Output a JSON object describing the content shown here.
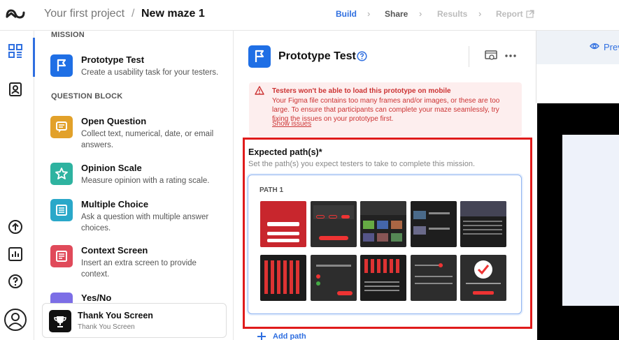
{
  "header": {
    "project": "Your first project",
    "separator": "/",
    "current": "New maze 1",
    "steps": [
      {
        "label": "Build",
        "state": "active"
      },
      {
        "label": "Share",
        "state": "normal"
      },
      {
        "label": "Results",
        "state": "disabled"
      },
      {
        "label": "Report",
        "state": "disabled"
      }
    ]
  },
  "rail": {
    "icons": [
      "blocks-icon",
      "templates-icon",
      "upload-icon",
      "analytics-icon",
      "help-icon",
      "account-icon"
    ]
  },
  "blocks": {
    "section_mission": "MISSION",
    "section_question": "QUESTION BLOCK",
    "items": [
      {
        "title": "Prototype Test",
        "desc": "Create a usability task for your testers.",
        "color": "#1f6fe5",
        "icon": "flag-icon"
      },
      {
        "title": "Open Question",
        "desc": "Collect text, numerical, date, or email answers.",
        "color": "#e2a12a",
        "icon": "chat-icon"
      },
      {
        "title": "Opinion Scale",
        "desc": "Measure opinion with a rating scale.",
        "color": "#2eb3a0",
        "icon": "star-icon"
      },
      {
        "title": "Multiple Choice",
        "desc": "Ask a question with multiple answer choices.",
        "color": "#2aa8c9",
        "icon": "list-icon"
      },
      {
        "title": "Context Screen",
        "desc": "Insert an extra screen to provide context.",
        "color": "#e04a5a",
        "icon": "document-icon"
      },
      {
        "title": "Yes/No",
        "desc": "",
        "color": "#7c6ee6",
        "icon": "yes-no-icon"
      }
    ],
    "thank_you": {
      "title": "Thank You Screen",
      "subtitle": "Thank You Screen",
      "color": "#111111",
      "icon": "trophy-icon"
    }
  },
  "editor": {
    "title": "Prototype Test",
    "warning": {
      "title": "Testers won't be able to load this prototype on mobile",
      "body": "Your Figma file contains too many frames and/or images, or these are too large. To ensure that participants can complete your maze seamlessly, try fixing the issues on your prototype first.",
      "link": "Show issues"
    },
    "expected_title": "Expected path(s)*",
    "expected_desc": "Set the path(s) you expect testers to take to complete this mission.",
    "path_label": "PATH 1",
    "add_path": "Add path"
  },
  "preview": {
    "label": "Prev"
  },
  "colors": {
    "accent": "#2f6fe0",
    "highlight": "#e01b1b",
    "warning_bg": "#fdeeee",
    "warning_text": "#cc3333"
  }
}
